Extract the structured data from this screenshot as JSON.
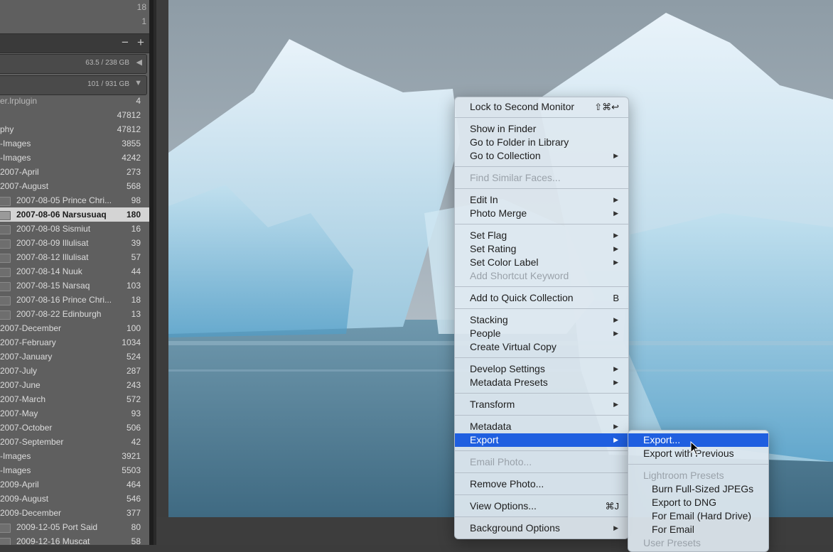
{
  "sidebar": {
    "top_counts": [
      "18",
      "1"
    ],
    "volumes": [
      {
        "label": "63.5 / 238 GB",
        "arrow": "◀"
      },
      {
        "label": "101 / 931 GB",
        "arrow": "▼"
      }
    ],
    "header_buttons": {
      "minus": "−",
      "plus": "+"
    },
    "folders": [
      {
        "name": "er.lrplugin",
        "count": "4",
        "dim": true
      },
      {
        "name": "",
        "count": "47812"
      },
      {
        "name": "phy",
        "count": "47812"
      },
      {
        "name": "-Images",
        "count": "3855"
      },
      {
        "name": "-Images",
        "count": "4242"
      },
      {
        "name": "2007-April",
        "count": "273"
      },
      {
        "name": "2007-August",
        "count": "568"
      },
      {
        "name": "2007-08-05 Prince Chri...",
        "count": "98",
        "sub": true
      },
      {
        "name": "2007-08-06 Narsusuaq",
        "count": "180",
        "sub": true,
        "selected": true
      },
      {
        "name": "2007-08-08 Sismiut",
        "count": "16",
        "sub": true
      },
      {
        "name": "2007-08-09 Illulisat",
        "count": "39",
        "sub": true
      },
      {
        "name": "2007-08-12 Illulisat",
        "count": "57",
        "sub": true
      },
      {
        "name": "2007-08-14 Nuuk",
        "count": "44",
        "sub": true
      },
      {
        "name": "2007-08-15 Narsaq",
        "count": "103",
        "sub": true
      },
      {
        "name": "2007-08-16 Prince Chri...",
        "count": "18",
        "sub": true
      },
      {
        "name": "2007-08-22 Edinburgh",
        "count": "13",
        "sub": true
      },
      {
        "name": "2007-December",
        "count": "100"
      },
      {
        "name": "2007-February",
        "count": "1034"
      },
      {
        "name": "2007-January",
        "count": "524"
      },
      {
        "name": "2007-July",
        "count": "287"
      },
      {
        "name": "2007-June",
        "count": "243"
      },
      {
        "name": "2007-March",
        "count": "572"
      },
      {
        "name": "2007-May",
        "count": "93"
      },
      {
        "name": "2007-October",
        "count": "506"
      },
      {
        "name": "2007-September",
        "count": "42"
      },
      {
        "name": "-Images",
        "count": "3921"
      },
      {
        "name": "-Images",
        "count": "5503"
      },
      {
        "name": "2009-April",
        "count": "464"
      },
      {
        "name": "2009-August",
        "count": "546"
      },
      {
        "name": "2009-December",
        "count": "377"
      },
      {
        "name": "2009-12-05 Port Said",
        "count": "80",
        "sub": true
      },
      {
        "name": "2009-12-16 Muscat",
        "count": "58",
        "sub": true
      }
    ]
  },
  "context_menu": {
    "items": [
      {
        "label": "Lock to Second Monitor",
        "shortcut": "⇧⌘↩"
      },
      {
        "sep": true
      },
      {
        "label": "Show in Finder"
      },
      {
        "label": "Go to Folder in Library"
      },
      {
        "label": "Go to Collection",
        "submenu": true
      },
      {
        "sep": true
      },
      {
        "label": "Find Similar Faces...",
        "disabled": true
      },
      {
        "sep": true
      },
      {
        "label": "Edit In",
        "submenu": true
      },
      {
        "label": "Photo Merge",
        "submenu": true
      },
      {
        "sep": true
      },
      {
        "label": "Set Flag",
        "submenu": true
      },
      {
        "label": "Set Rating",
        "submenu": true
      },
      {
        "label": "Set Color Label",
        "submenu": true
      },
      {
        "label": "Add Shortcut Keyword",
        "disabled": true
      },
      {
        "sep": true
      },
      {
        "label": "Add to Quick Collection",
        "shortcut": "B"
      },
      {
        "sep": true
      },
      {
        "label": "Stacking",
        "submenu": true
      },
      {
        "label": "People",
        "submenu": true
      },
      {
        "label": "Create Virtual Copy"
      },
      {
        "sep": true
      },
      {
        "label": "Develop Settings",
        "submenu": true
      },
      {
        "label": "Metadata Presets",
        "submenu": true
      },
      {
        "sep": true
      },
      {
        "label": "Transform",
        "submenu": true
      },
      {
        "sep": true
      },
      {
        "label": "Metadata",
        "submenu": true
      },
      {
        "label": "Export",
        "submenu": true,
        "highlighted": true
      },
      {
        "sep": true
      },
      {
        "label": "Email Photo...",
        "disabled": true
      },
      {
        "sep": true
      },
      {
        "label": "Remove Photo..."
      },
      {
        "sep": true
      },
      {
        "label": "View Options...",
        "shortcut": "⌘J"
      },
      {
        "sep": true
      },
      {
        "label": "Background Options",
        "submenu": true
      }
    ]
  },
  "export_submenu": {
    "items": [
      {
        "label": "Export...",
        "highlighted": true
      },
      {
        "label": "Export with Previous"
      },
      {
        "sep": true
      },
      {
        "label": "Lightroom Presets",
        "section": true
      },
      {
        "label": "Burn Full-Sized JPEGs",
        "indent": true
      },
      {
        "label": "Export to DNG",
        "indent": true
      },
      {
        "label": "For Email (Hard Drive)",
        "indent": true
      },
      {
        "label": "For Email",
        "indent": true
      },
      {
        "label": "User Presets",
        "section": true
      }
    ]
  },
  "colors": {
    "highlight": "#1f5fe0",
    "menu_bg": "#dfe8f0",
    "panel_bg": "#5f5f5f",
    "selected_row": "#d4d4d4"
  }
}
